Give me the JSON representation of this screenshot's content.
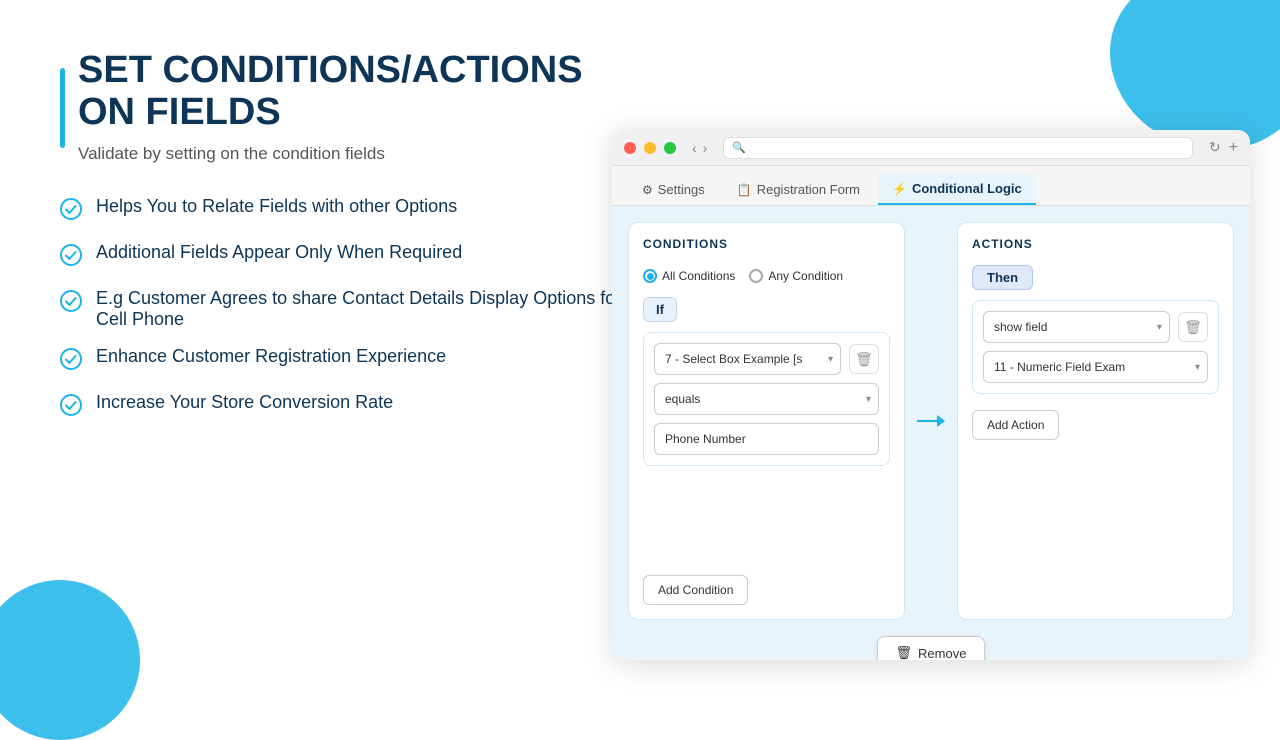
{
  "page": {
    "title": "SET CONDITIONS/ACTIONS ON FIELDS",
    "subtitle": "Validate by setting on the condition fields"
  },
  "bullets": [
    "Helps You to Relate Fields with other Options",
    "Additional Fields Appear Only When Required",
    "E.g Customer Agrees to share Contact Details Display Options for Cell Phone",
    "Enhance Customer Registration Experience",
    "Increase Your Store Conversion Rate"
  ],
  "browser": {
    "tabs": [
      {
        "label": "Settings",
        "icon": "⚙",
        "active": false
      },
      {
        "label": "Registration Form",
        "icon": "📋",
        "active": false
      },
      {
        "label": "Conditional Logic",
        "icon": "⚡",
        "active": true
      }
    ]
  },
  "conditions": {
    "title": "CONDITIONS",
    "radio_all": "All Conditions",
    "radio_any": "Any Condition",
    "if_label": "If",
    "select1_value": "7 - Select Box Example [s",
    "select2_value": "equals",
    "input_value": "Phone Number",
    "add_btn": "Add Condition"
  },
  "actions": {
    "title": "ACTIONS",
    "then_label": "Then",
    "action_select": "show field",
    "field_select": "11 - Numeric Field Exam",
    "add_btn": "Add Action"
  },
  "remove_btn": "Remove",
  "icons": {
    "check_circle": "✓",
    "trash": "🗑",
    "back": "‹",
    "forward": "›",
    "reload": "↻",
    "search": "🔍",
    "down_arrow": "▾",
    "arrow_right": "→",
    "gear": "⚙",
    "doc": "📋",
    "lightning": "⚡"
  }
}
